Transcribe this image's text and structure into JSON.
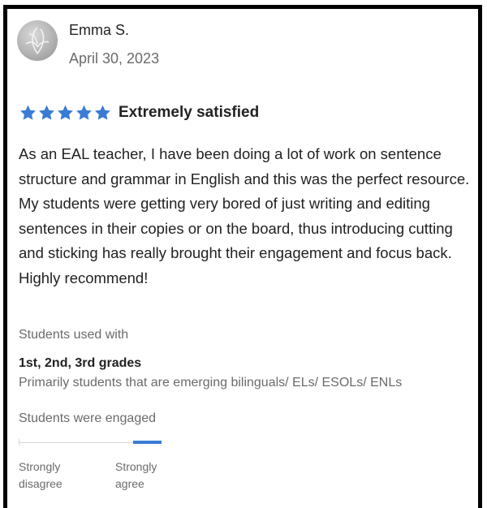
{
  "reviewer": {
    "name": "Emma S.",
    "date": "April 30, 2023",
    "avatar_icon": "leaf-logo-icon"
  },
  "rating": {
    "stars": 5,
    "max_stars": 5,
    "star_color": "#3a7bd5",
    "label": "Extremely satisfied"
  },
  "review": {
    "text": "As an EAL teacher, I have been doing a lot of work on sentence structure and grammar in English and this was the perfect resource. My students were getting very bored of just writing and editing sentences in their copies or on the board, thus introducing cutting and sticking has really brought their engagement and focus back. Highly recommend!"
  },
  "students_used_with": {
    "label": "Students used with",
    "grades": "1st, 2nd, 3rd grades",
    "description": "Primarily students that are emerging bilinguals/ ELs/ ESOLs/ ENLs"
  },
  "engagement": {
    "label": "Students were engaged",
    "level_fraction": 1.0,
    "fill_color": "#3a7bd5",
    "track_color": "#d6d6d6",
    "low_label_line1": "Strongly",
    "low_label_line2": "disagree",
    "high_label_line1": "Strongly",
    "high_label_line2": "agree"
  }
}
